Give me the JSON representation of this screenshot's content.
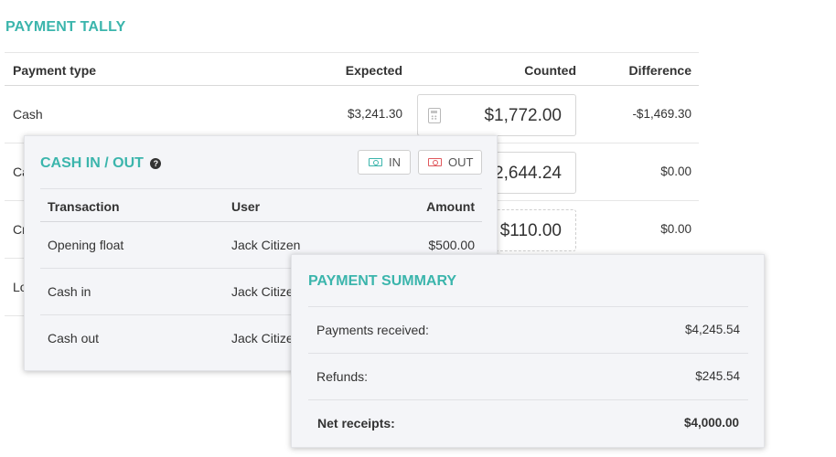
{
  "tally": {
    "title": "PAYMENT TALLY",
    "headers": {
      "type": "Payment type",
      "expected": "Expected",
      "counted": "Counted",
      "difference": "Difference"
    },
    "rows": [
      {
        "type": "Cash",
        "expected": "$3,241.30",
        "counted": "$1,772.00",
        "difference": "-$1,469.30"
      },
      {
        "type": "Ca",
        "expected": "",
        "counted": "2,644.24",
        "difference": "$0.00"
      },
      {
        "type": "Cr",
        "expected": "",
        "counted": "$110.00",
        "difference": "$0.00"
      },
      {
        "type": "Lo",
        "expected": "",
        "counted": "",
        "difference": ""
      }
    ]
  },
  "cash": {
    "title": "CASH IN / OUT",
    "help": "?",
    "in_label": "IN",
    "out_label": "OUT",
    "headers": {
      "transaction": "Transaction",
      "user": "User",
      "amount": "Amount"
    },
    "rows": [
      {
        "transaction": "Opening float",
        "user": "Jack Citizen",
        "amount": "$500.00"
      },
      {
        "transaction": "Cash in",
        "user": "Jack Citizen",
        "amount": ""
      },
      {
        "transaction": "Cash out",
        "user": "Jack Citizen",
        "amount": ""
      }
    ]
  },
  "summary": {
    "title": "PAYMENT SUMMARY",
    "rows": [
      {
        "label": "Payments received:",
        "value": "$4,245.54"
      },
      {
        "label": "Refunds:",
        "value": "$245.54"
      },
      {
        "label": "Net receipts:",
        "value": "$4,000.00"
      }
    ]
  },
  "colors": {
    "accent": "#3bb5ac",
    "out_red": "#e0595d"
  },
  "icons": {
    "calculator": "calculator-icon",
    "help": "help-icon",
    "cash_in": "money-in-icon",
    "cash_out": "money-out-icon"
  }
}
